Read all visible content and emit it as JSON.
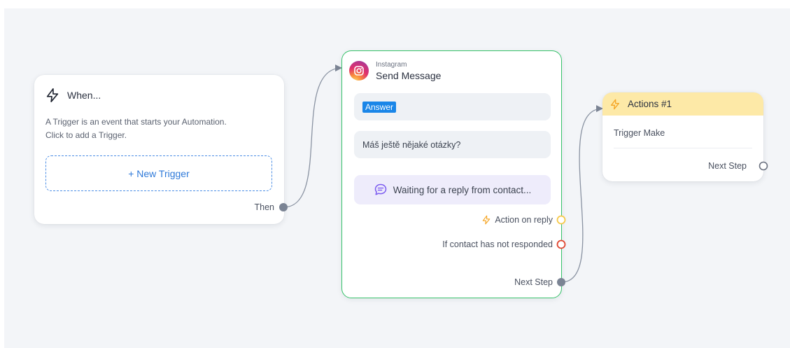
{
  "trigger": {
    "title": "When...",
    "description_line1": "A Trigger is an event that starts your Automation.",
    "description_line2": "Click to add a Trigger.",
    "new_trigger_label": "+ New Trigger",
    "then_label": "Then"
  },
  "message": {
    "channel": "Instagram",
    "title": "Send Message",
    "answer_tag": "Answer",
    "message_text": "Máš ještě nějaké otázky?",
    "waiting_text": "Waiting for a reply from contact...",
    "action_on_reply": "Action on reply",
    "no_response": "If contact has not responded",
    "next_step": "Next Step"
  },
  "actions": {
    "title": "Actions #1",
    "item": "Trigger Make",
    "next_step": "Next Step"
  },
  "colors": {
    "selected_border": "#37c26a",
    "action_on_reply": "#f5b324",
    "no_response": "#e0452f",
    "link_blue": "#2f7ad9",
    "actions_header": "#fde9a7"
  }
}
